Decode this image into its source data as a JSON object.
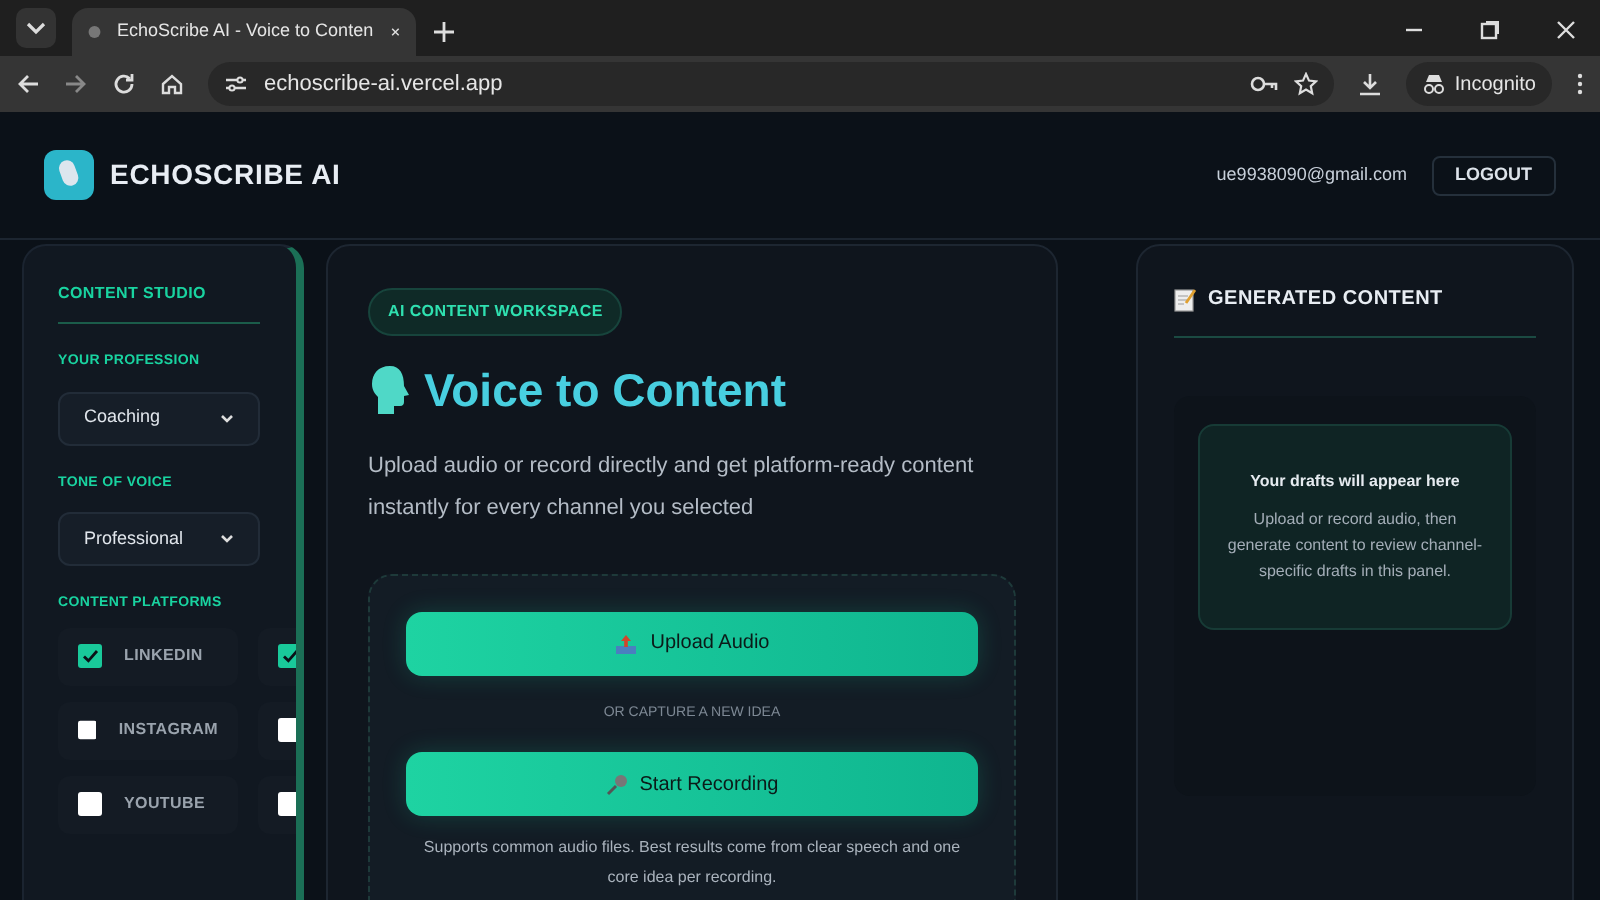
{
  "browser": {
    "tab_title": "EchoScribe AI - Voice to Conten",
    "url": "echoscribe-ai.vercel.app",
    "profile": "Incognito"
  },
  "header": {
    "brand": "ECHOSCRIBE AI",
    "email": "ue9938090@gmail.com",
    "logout": "LOGOUT"
  },
  "sidebar": {
    "title": "CONTENT STUDIO",
    "fields": [
      {
        "label": "YOUR PROFESSION",
        "value": "Coaching"
      },
      {
        "label": "TONE OF VOICE",
        "value": "Professional"
      }
    ],
    "platforms_label": "CONTENT PLATFORMS",
    "platforms": [
      {
        "label": "LINKEDIN",
        "checked": true
      },
      {
        "checked": true
      },
      {
        "label": "INSTAGRAM",
        "checked": false
      },
      {
        "checked": false
      },
      {
        "label": "YOUTUBE",
        "checked": false
      },
      {
        "checked": false
      }
    ]
  },
  "workspace": {
    "badge": "AI CONTENT WORKSPACE",
    "title": "Voice to Content",
    "description": "Upload audio or record directly and get platform-ready content instantly for every channel you selected",
    "upload_button": "Upload Audio",
    "divider": "OR CAPTURE A NEW IDEA",
    "record_button": "Start Recording",
    "hint": "Supports common audio files. Best results come from clear speech and one core idea per recording."
  },
  "output": {
    "title": "GENERATED CONTENT",
    "empty_title": "Your drafts will appear here",
    "empty_text": "Upload or record audio, then generate content to review channel-specific drafts in this panel."
  }
}
